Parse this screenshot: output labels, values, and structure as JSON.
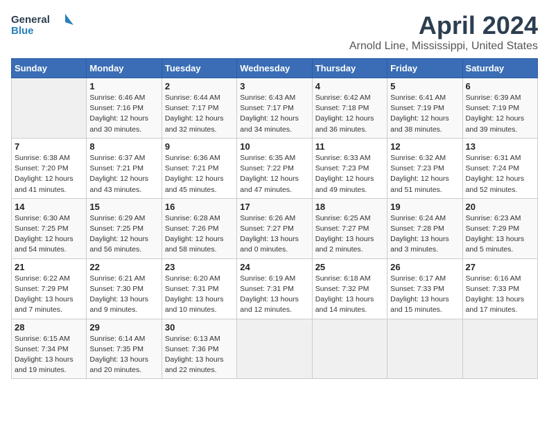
{
  "header": {
    "logo_general": "General",
    "logo_blue": "Blue",
    "title": "April 2024",
    "subtitle": "Arnold Line, Mississippi, United States"
  },
  "days_of_week": [
    "Sunday",
    "Monday",
    "Tuesday",
    "Wednesday",
    "Thursday",
    "Friday",
    "Saturday"
  ],
  "weeks": [
    [
      {
        "day": "",
        "info": ""
      },
      {
        "day": "1",
        "info": "Sunrise: 6:46 AM\nSunset: 7:16 PM\nDaylight: 12 hours\nand 30 minutes."
      },
      {
        "day": "2",
        "info": "Sunrise: 6:44 AM\nSunset: 7:17 PM\nDaylight: 12 hours\nand 32 minutes."
      },
      {
        "day": "3",
        "info": "Sunrise: 6:43 AM\nSunset: 7:17 PM\nDaylight: 12 hours\nand 34 minutes."
      },
      {
        "day": "4",
        "info": "Sunrise: 6:42 AM\nSunset: 7:18 PM\nDaylight: 12 hours\nand 36 minutes."
      },
      {
        "day": "5",
        "info": "Sunrise: 6:41 AM\nSunset: 7:19 PM\nDaylight: 12 hours\nand 38 minutes."
      },
      {
        "day": "6",
        "info": "Sunrise: 6:39 AM\nSunset: 7:19 PM\nDaylight: 12 hours\nand 39 minutes."
      }
    ],
    [
      {
        "day": "7",
        "info": "Sunrise: 6:38 AM\nSunset: 7:20 PM\nDaylight: 12 hours\nand 41 minutes."
      },
      {
        "day": "8",
        "info": "Sunrise: 6:37 AM\nSunset: 7:21 PM\nDaylight: 12 hours\nand 43 minutes."
      },
      {
        "day": "9",
        "info": "Sunrise: 6:36 AM\nSunset: 7:21 PM\nDaylight: 12 hours\nand 45 minutes."
      },
      {
        "day": "10",
        "info": "Sunrise: 6:35 AM\nSunset: 7:22 PM\nDaylight: 12 hours\nand 47 minutes."
      },
      {
        "day": "11",
        "info": "Sunrise: 6:33 AM\nSunset: 7:23 PM\nDaylight: 12 hours\nand 49 minutes."
      },
      {
        "day": "12",
        "info": "Sunrise: 6:32 AM\nSunset: 7:23 PM\nDaylight: 12 hours\nand 51 minutes."
      },
      {
        "day": "13",
        "info": "Sunrise: 6:31 AM\nSunset: 7:24 PM\nDaylight: 12 hours\nand 52 minutes."
      }
    ],
    [
      {
        "day": "14",
        "info": "Sunrise: 6:30 AM\nSunset: 7:25 PM\nDaylight: 12 hours\nand 54 minutes."
      },
      {
        "day": "15",
        "info": "Sunrise: 6:29 AM\nSunset: 7:25 PM\nDaylight: 12 hours\nand 56 minutes."
      },
      {
        "day": "16",
        "info": "Sunrise: 6:28 AM\nSunset: 7:26 PM\nDaylight: 12 hours\nand 58 minutes."
      },
      {
        "day": "17",
        "info": "Sunrise: 6:26 AM\nSunset: 7:27 PM\nDaylight: 13 hours\nand 0 minutes."
      },
      {
        "day": "18",
        "info": "Sunrise: 6:25 AM\nSunset: 7:27 PM\nDaylight: 13 hours\nand 2 minutes."
      },
      {
        "day": "19",
        "info": "Sunrise: 6:24 AM\nSunset: 7:28 PM\nDaylight: 13 hours\nand 3 minutes."
      },
      {
        "day": "20",
        "info": "Sunrise: 6:23 AM\nSunset: 7:29 PM\nDaylight: 13 hours\nand 5 minutes."
      }
    ],
    [
      {
        "day": "21",
        "info": "Sunrise: 6:22 AM\nSunset: 7:29 PM\nDaylight: 13 hours\nand 7 minutes."
      },
      {
        "day": "22",
        "info": "Sunrise: 6:21 AM\nSunset: 7:30 PM\nDaylight: 13 hours\nand 9 minutes."
      },
      {
        "day": "23",
        "info": "Sunrise: 6:20 AM\nSunset: 7:31 PM\nDaylight: 13 hours\nand 10 minutes."
      },
      {
        "day": "24",
        "info": "Sunrise: 6:19 AM\nSunset: 7:31 PM\nDaylight: 13 hours\nand 12 minutes."
      },
      {
        "day": "25",
        "info": "Sunrise: 6:18 AM\nSunset: 7:32 PM\nDaylight: 13 hours\nand 14 minutes."
      },
      {
        "day": "26",
        "info": "Sunrise: 6:17 AM\nSunset: 7:33 PM\nDaylight: 13 hours\nand 15 minutes."
      },
      {
        "day": "27",
        "info": "Sunrise: 6:16 AM\nSunset: 7:33 PM\nDaylight: 13 hours\nand 17 minutes."
      }
    ],
    [
      {
        "day": "28",
        "info": "Sunrise: 6:15 AM\nSunset: 7:34 PM\nDaylight: 13 hours\nand 19 minutes."
      },
      {
        "day": "29",
        "info": "Sunrise: 6:14 AM\nSunset: 7:35 PM\nDaylight: 13 hours\nand 20 minutes."
      },
      {
        "day": "30",
        "info": "Sunrise: 6:13 AM\nSunset: 7:36 PM\nDaylight: 13 hours\nand 22 minutes."
      },
      {
        "day": "",
        "info": ""
      },
      {
        "day": "",
        "info": ""
      },
      {
        "day": "",
        "info": ""
      },
      {
        "day": "",
        "info": ""
      }
    ]
  ]
}
